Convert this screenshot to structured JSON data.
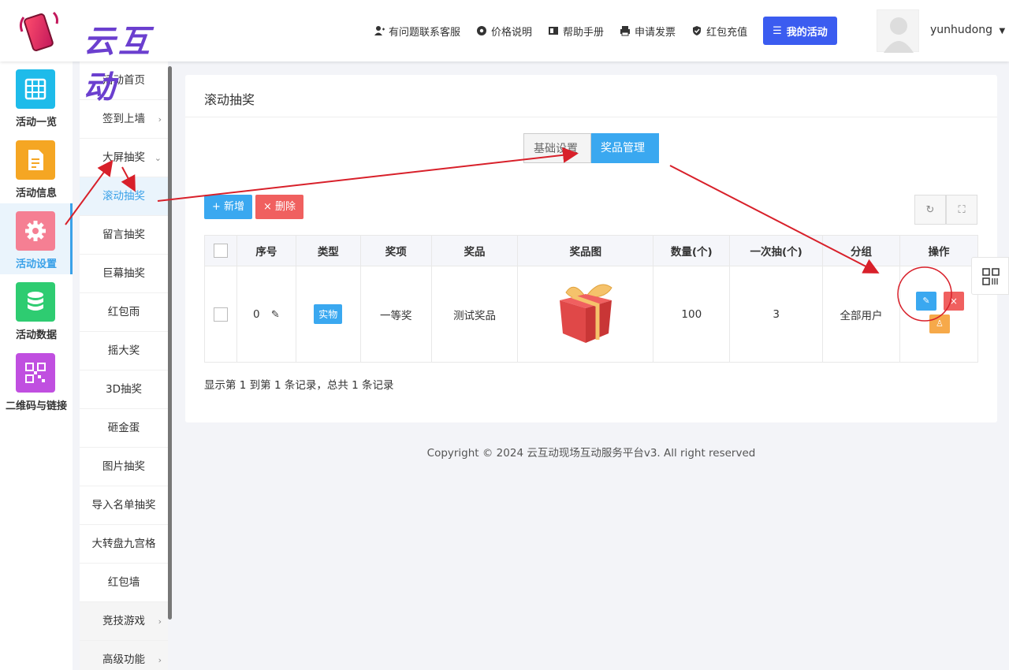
{
  "brand": {
    "name": "云互动"
  },
  "header": {
    "nav": [
      {
        "label": "有问题联系客服",
        "icon": "user-plus-icon"
      },
      {
        "label": "价格说明",
        "icon": "gear-icon"
      },
      {
        "label": "帮助手册",
        "icon": "book-icon"
      },
      {
        "label": "申请发票",
        "icon": "printer-icon"
      },
      {
        "label": "红包充值",
        "icon": "shield-check-icon"
      }
    ],
    "my_activity": "我的活动",
    "username": "yunhudong"
  },
  "sidebar1": {
    "items": [
      {
        "label": "活动一览",
        "icon": "grid-icon",
        "color": "#1ebbea"
      },
      {
        "label": "活动信息",
        "icon": "document-icon",
        "color": "#f5a623"
      },
      {
        "label": "活动设置",
        "icon": "gear-icon",
        "color": "#f57f93"
      },
      {
        "label": "活动数据",
        "icon": "database-icon",
        "color": "#2ecc71"
      },
      {
        "label": "二维码与链接",
        "icon": "qrcode-icon",
        "color": "#c04fe0"
      }
    ]
  },
  "sidebar2": {
    "items": [
      {
        "label": "活动首页"
      },
      {
        "label": "签到上墙",
        "chevron": "›"
      },
      {
        "label": "大屏抽奖",
        "chevron": "⌄"
      },
      {
        "label": "滚动抽奖"
      },
      {
        "label": "留言抽奖"
      },
      {
        "label": "巨幕抽奖"
      },
      {
        "label": "红包雨"
      },
      {
        "label": "摇大奖"
      },
      {
        "label": "3D抽奖"
      },
      {
        "label": "砸金蛋"
      },
      {
        "label": "图片抽奖"
      },
      {
        "label": "导入名单抽奖"
      },
      {
        "label": "大转盘九宫格"
      },
      {
        "label": "红包墙"
      },
      {
        "label": "竞技游戏",
        "chevron": "›"
      },
      {
        "label": "高级功能",
        "chevron": "›"
      }
    ]
  },
  "main": {
    "title": "滚动抽奖",
    "tabs": [
      "基础设置",
      "奖品管理"
    ],
    "buttons": {
      "add": "+ 新增",
      "delete": "× 删除"
    },
    "table": {
      "headers": [
        "序号",
        "类型",
        "奖项",
        "奖品",
        "奖品图",
        "数量(个)",
        "一次抽(个)",
        "分组",
        "操作"
      ],
      "rows": [
        {
          "index": "0",
          "type": "实物",
          "award": "一等奖",
          "prize": "测试奖品",
          "quantity": "100",
          "per_draw": "3",
          "group": "全部用户"
        }
      ]
    },
    "records": "显示第 1 到第 1 条记录，总共 1 条记录"
  },
  "footer": {
    "copyright": "Copyright © 2024 云互动现场互动服务平台v3. All right reserved"
  },
  "colors": {
    "accent": "#3aa8f0",
    "danger": "#f0605f",
    "warning": "#f6a94a",
    "annotation": "#d8202a"
  }
}
